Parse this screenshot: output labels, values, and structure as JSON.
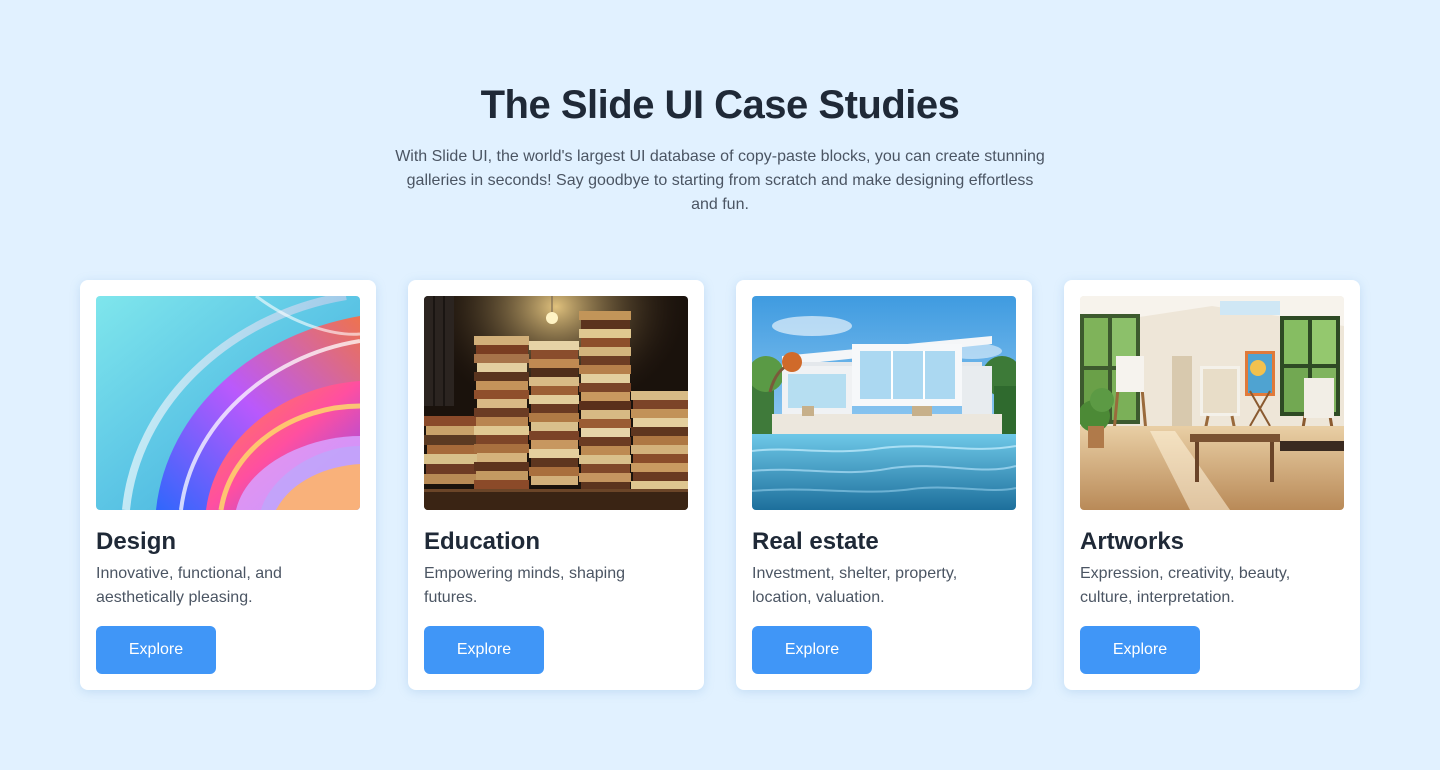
{
  "header": {
    "title": "The Slide UI Case Studies",
    "subtitle": "With Slide UI, the world's largest UI database of copy-paste blocks, you can create stunning galleries in seconds! Say goodbye to starting from scratch and make designing effortless and fun."
  },
  "cards": [
    {
      "title": "Design",
      "description": "Innovative, functional, and aesthetically pleasing.",
      "button_label": "Explore",
      "image": "abstract-glass-swirl-image"
    },
    {
      "title": "Education",
      "description": "Empowering minds, shaping futures.",
      "button_label": "Explore",
      "image": "stacked-books-image"
    },
    {
      "title": "Real estate",
      "description": "Investment, shelter, property, location, valuation.",
      "button_label": "Explore",
      "image": "modern-villa-pool-image"
    },
    {
      "title": "Artworks",
      "description": "Expression, creativity, beauty, culture, interpretation.",
      "button_label": "Explore",
      "image": "art-studio-image"
    }
  ],
  "colors": {
    "background": "#e1f1ff",
    "button": "#4096f7",
    "heading": "#1f2937",
    "body_text": "#4b5563"
  }
}
